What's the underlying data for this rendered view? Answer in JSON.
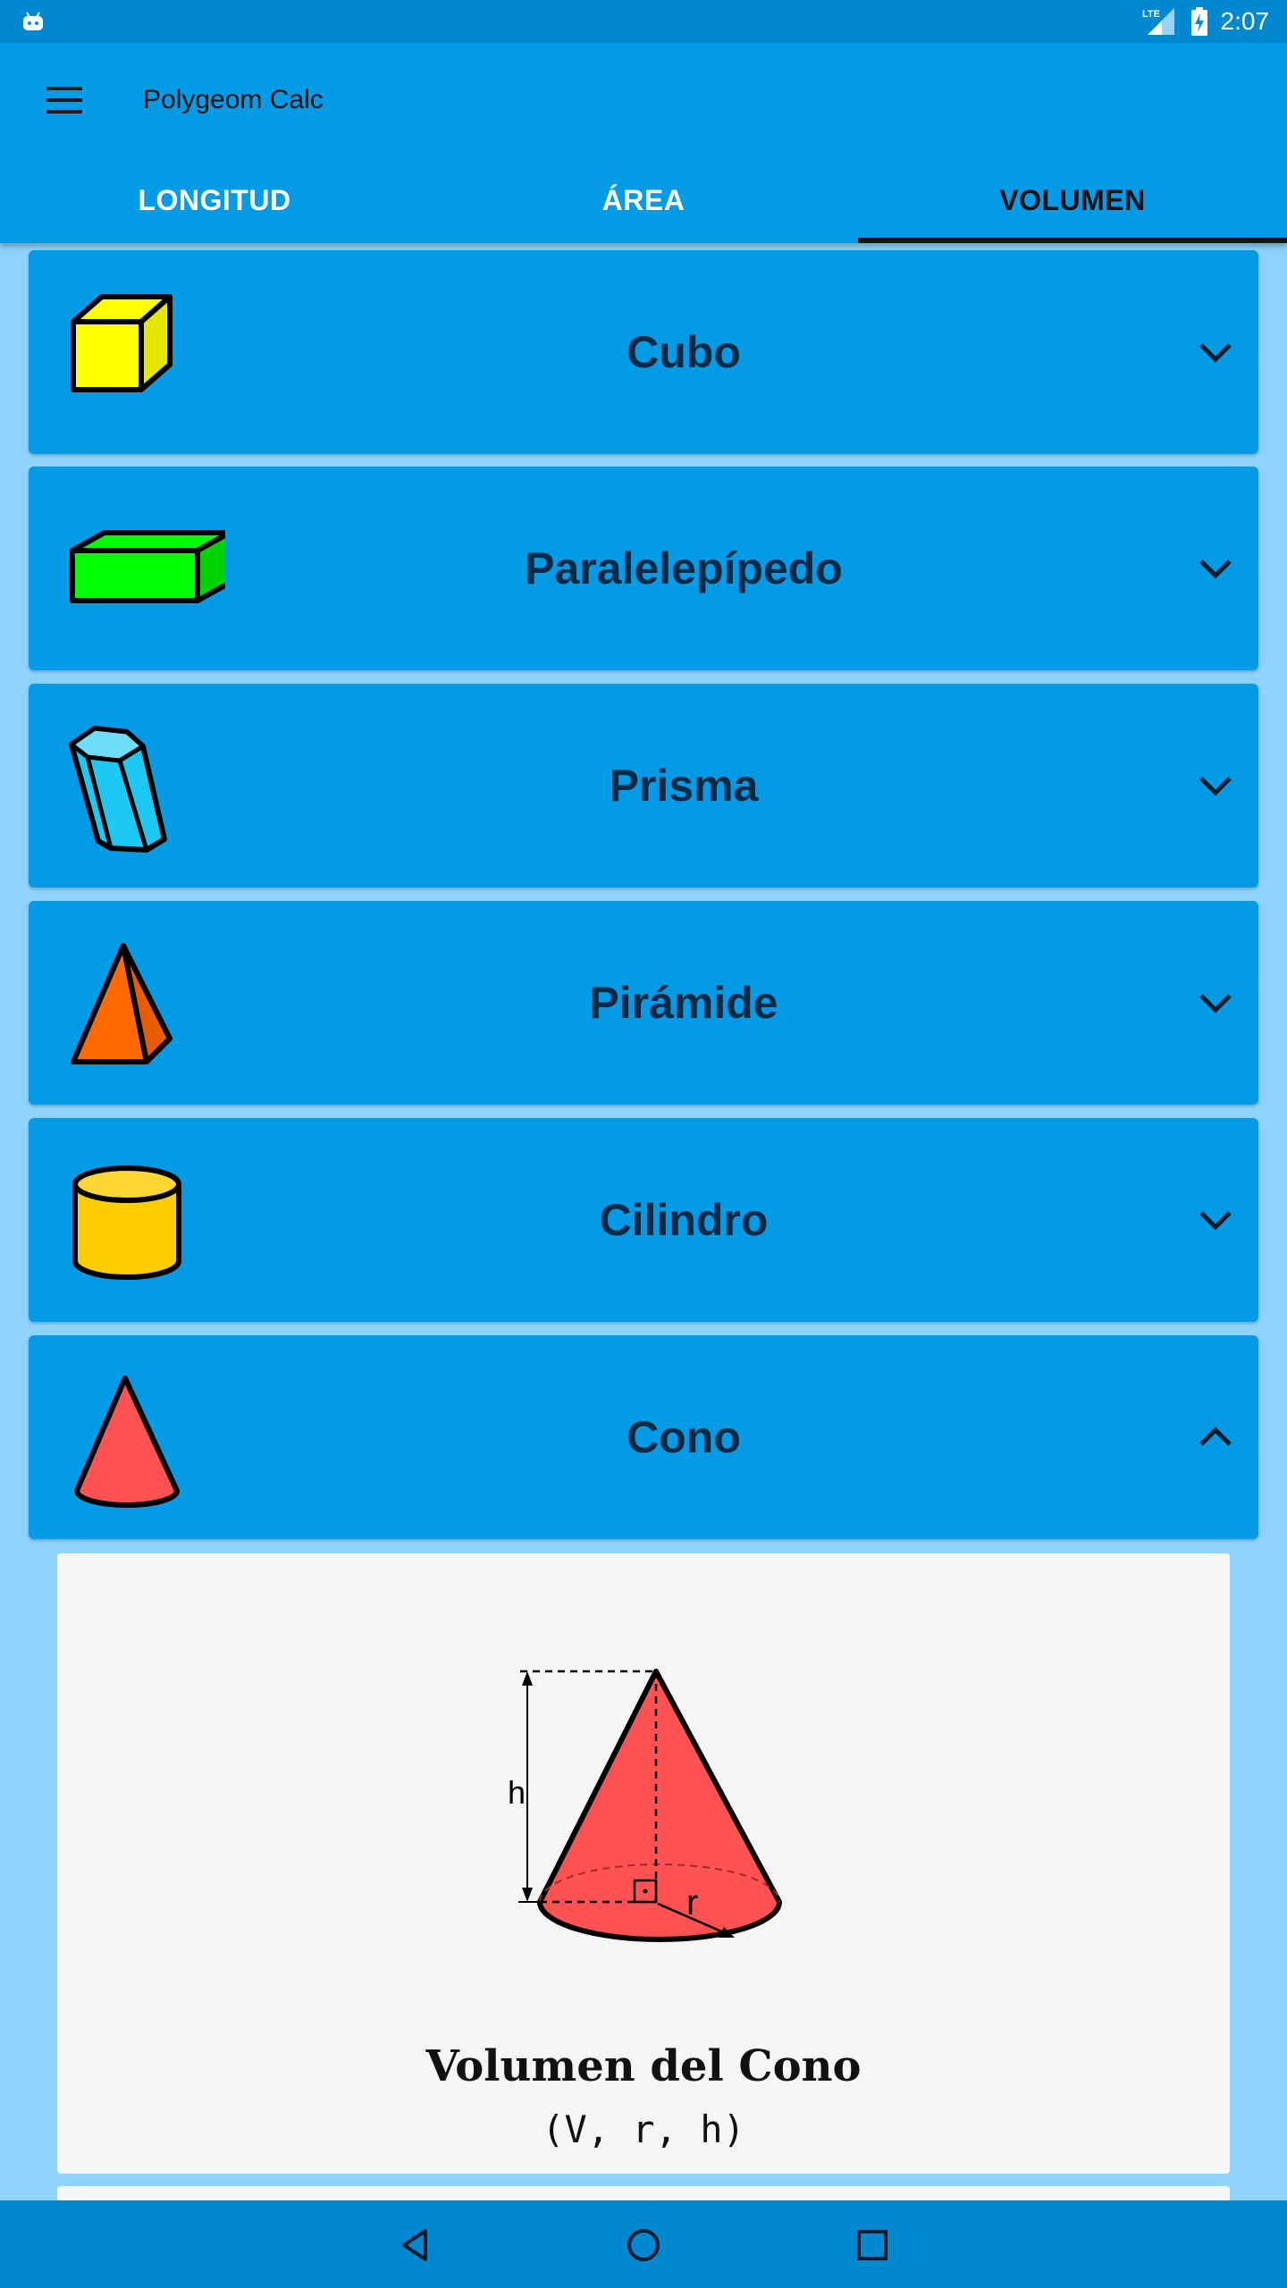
{
  "status_bar": {
    "time": "2:07",
    "network": "LTE",
    "icons": [
      "notification-icon",
      "lte-signal-icon",
      "battery-charging-icon"
    ]
  },
  "app_bar": {
    "title": "Polygeom Calc",
    "menu_icon": "hamburger-menu-icon"
  },
  "tabs": [
    {
      "label": "LONGITUD",
      "active": false
    },
    {
      "label": "ÁREA",
      "active": false
    },
    {
      "label": "VOLUMEN",
      "active": true
    }
  ],
  "shapes": [
    {
      "label": "Cubo",
      "icon": "cube-icon",
      "color": "#ffff00",
      "expanded": false
    },
    {
      "label": "Paralelepípedo",
      "icon": "cuboid-icon",
      "color": "#00ff00",
      "expanded": false
    },
    {
      "label": "Prisma",
      "icon": "prism-icon",
      "color": "#1ec8f5",
      "expanded": false
    },
    {
      "label": "Pirámide",
      "icon": "pyramid-icon",
      "color": "#ff6a00",
      "expanded": false
    },
    {
      "label": "Cilindro",
      "icon": "cylinder-icon",
      "color": "#ffcc00",
      "expanded": false
    },
    {
      "label": "Cono",
      "icon": "cone-icon",
      "color": "#ff5252",
      "expanded": true
    }
  ],
  "detail": {
    "diagram_labels": {
      "height": "h",
      "radius": "r"
    },
    "title": "Volumen del Cono",
    "formula": "(V, r, h)"
  },
  "nav_bar": {
    "buttons": [
      "back-icon",
      "home-icon",
      "recents-icon"
    ]
  },
  "colors": {
    "status_bar": "#0288d1",
    "app_bar": "#039be5",
    "background": "#8ed3fa",
    "card": "#039be5",
    "detail_panel": "#f5f5f5"
  }
}
